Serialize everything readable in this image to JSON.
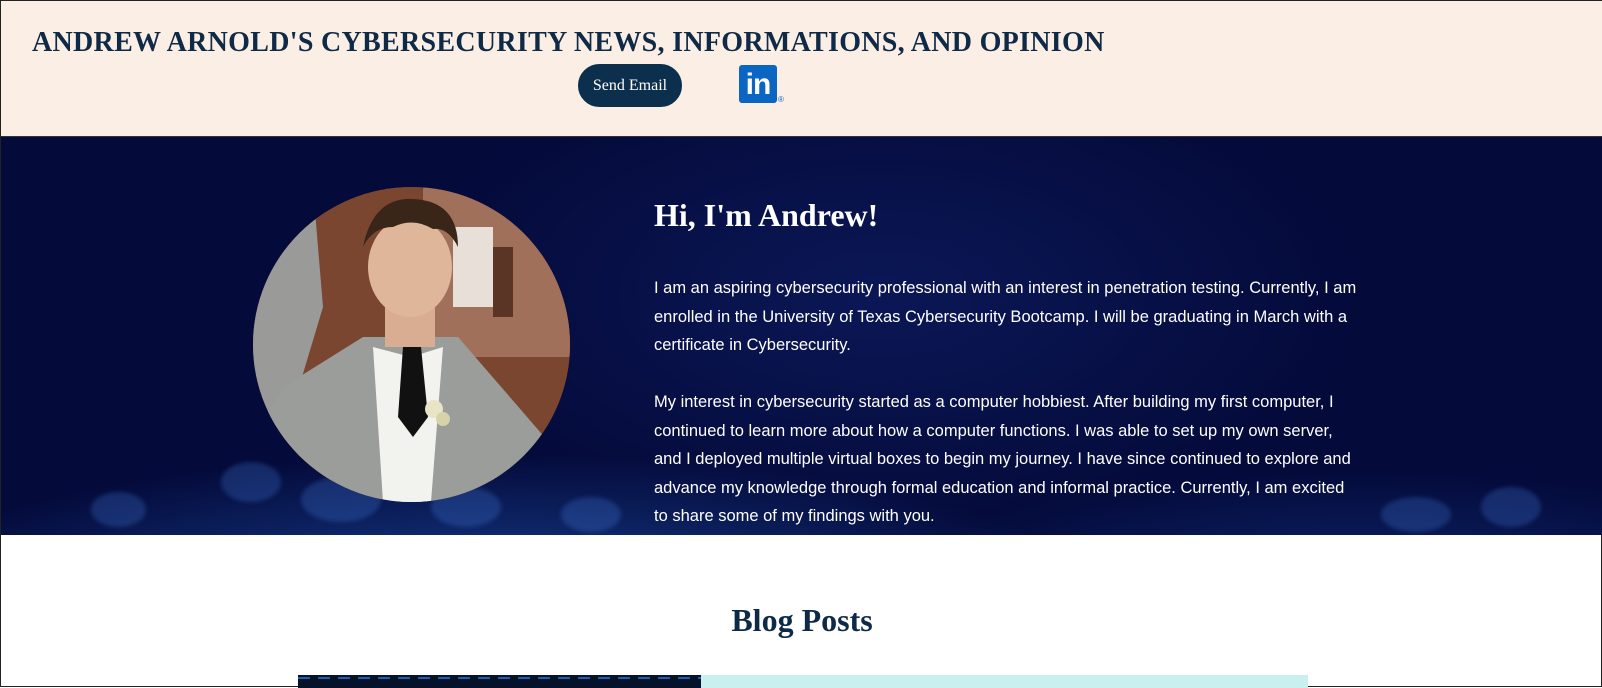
{
  "header": {
    "title": "ANDREW ARNOLD'S CYBERSECURITY NEWS, INFORMATIONS, AND OPINION",
    "email_button": "Send Email",
    "linkedin_icon": "linkedin-icon",
    "linkedin_text": "in"
  },
  "hero": {
    "heading": "Hi, I'm Andrew!",
    "paragraph_1": "I am an aspiring cybersecurity professional with an interest in penetration testing. Currently, I am enrolled in the University of Texas Cybersecurity Bootcamp. I will be graduating in March with a certificate in Cybersecurity.",
    "paragraph_2": "My interest in cybersecurity started as a computer hobbiest. After building my first computer, I continued to learn more about how a computer functions. I was able to set up my own server, and I deployed multiple virtual boxes to begin my journey. I have since continued to explore and advance my knowledge through formal education and informal practice. Currently, I am excited to share some of my findings with you."
  },
  "blog": {
    "heading": "Blog Posts"
  },
  "colors": {
    "header_bg": "#fbefe5",
    "navy": "#0f2a47",
    "hero_bg": "#040a3a",
    "linkedin_blue": "#0a66c2",
    "card_accent": "#c9f0ee"
  }
}
